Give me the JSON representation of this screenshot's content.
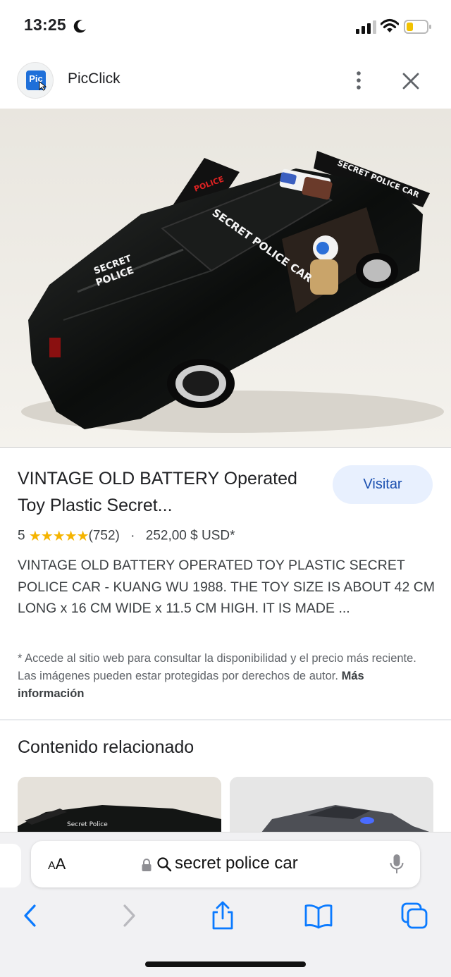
{
  "status_bar": {
    "time": "13:25",
    "icons": [
      "moon-icon",
      "cellular-signal-icon",
      "wifi-icon",
      "battery-low-icon"
    ],
    "battery_color": "#f2c200"
  },
  "site": {
    "logo_text": "Pic",
    "name": "PicClick",
    "brand_color": "#1e6fd9"
  },
  "result": {
    "title": "VINTAGE OLD BATTERY Operated Toy Plastic Secret...",
    "visit_label": "Visitar",
    "rating_value": "5",
    "stars": "★★★★★",
    "review_count": "(752)",
    "separator": "·",
    "price": "252,00 $ USD*",
    "description": "VINTAGE OLD BATTERY OPERATED TOY PLASTIC SECRET POLICE CAR - KUANG WU 1988. THE TOY SIZE IS ABOUT 42 CM LONG x 16 CM WIDE x 11.5 CM HIGH. IT IS MADE ...",
    "disclaimer": "* Accede al sitio web para consultar la disponibilidad y el precio más reciente. Las imágenes pueden estar protegidas por derechos de autor.",
    "more_info": "Más información",
    "star_color": "#f5b400"
  },
  "related": {
    "heading": "Contenido relacionado"
  },
  "browser": {
    "aa_label_small": "A",
    "aa_label_big": "A",
    "address_text": "secret police car",
    "nav_icons": [
      "back-icon",
      "forward-icon",
      "share-icon",
      "bookmarks-icon",
      "tabs-icon"
    ],
    "accent": "#0a7aff"
  }
}
